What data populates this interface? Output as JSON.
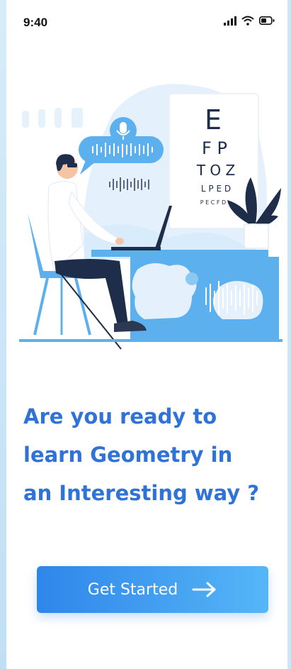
{
  "status_bar": {
    "time": "9:40",
    "icons": [
      "signal-icon",
      "wifi-icon",
      "battery-icon"
    ]
  },
  "illustration": {
    "eye_chart_rows": [
      "E",
      "F P",
      "T O Z",
      "L P E D",
      "P E C F D"
    ]
  },
  "headline": {
    "line1": "Are you ready to",
    "line2": "learn Geometry in",
    "line3": "an Interesting way ?"
  },
  "cta": {
    "label": "Get Started",
    "icon": "arrow-right-icon"
  },
  "colors": {
    "accent": "#2f73d8",
    "button_start": "#2f86ea",
    "button_end": "#55b6f7",
    "illustration_light": "#d8ecfb",
    "illustration_mid": "#5cb0ee"
  }
}
